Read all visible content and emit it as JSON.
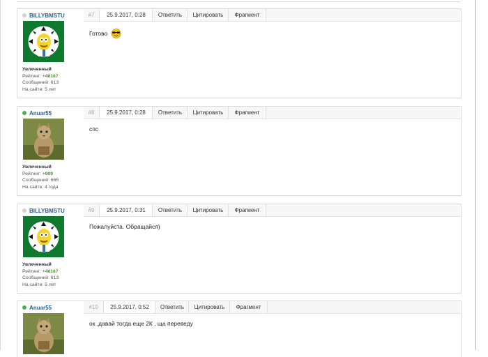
{
  "posts": [
    {
      "author": "BILLYBMSTU",
      "online": false,
      "number": "#7",
      "date": "25.9.2017, 0:28",
      "actions": [
        "Ответить",
        "Цитировать",
        "Фрагмент"
      ],
      "rank": "Увлеченный",
      "rating_label": "Рейтинг:",
      "rating": "+46167",
      "messages": "Сообщений: 613",
      "on_site": "На сайте: 5 лет",
      "text": "Готово",
      "has_smiley": true
    },
    {
      "author": "Anuar55",
      "online": true,
      "number": "#8",
      "date": "25.9.2017, 0:28",
      "actions": [
        "Ответить",
        "Цитировать",
        "Фрагмент"
      ],
      "rank": "Увлеченный",
      "rating_label": "Рейтинг:",
      "rating": "+909",
      "messages": "Сообщений: 665",
      "on_site": "На сайте: 4 года",
      "text": "спс"
    },
    {
      "author": "BILLYBMSTU",
      "online": false,
      "number": "#9",
      "date": "25.9.2017, 0:31",
      "actions": [
        "Ответить",
        "Цитировать",
        "Фрагмент"
      ],
      "rank": "Увлеченный",
      "rating_label": "Рейтинг:",
      "rating": "+46167",
      "messages": "Сообщений: 613",
      "on_site": "На сайте: 5 лет",
      "text": "Пожалуйста. Обращайся)"
    },
    {
      "author": "Anuar55",
      "online": true,
      "number": "#10",
      "date": "25.9.2017, 0:52",
      "actions": [
        "Ответить",
        "Цитировать",
        "Фрагмент"
      ],
      "text": "ок ,давай тогда еще 2К , ща переведу"
    }
  ],
  "colors": {
    "online": "#4caf50",
    "offline": "#d0d0d0",
    "author": "#2e5f8a",
    "rating": "#4d8f2c"
  },
  "icons": {
    "avatar_billy": "homer-simpson-avatar",
    "avatar_anuar": "cat-avatar",
    "smiley": "cool-sunglasses-smiley-icon"
  }
}
